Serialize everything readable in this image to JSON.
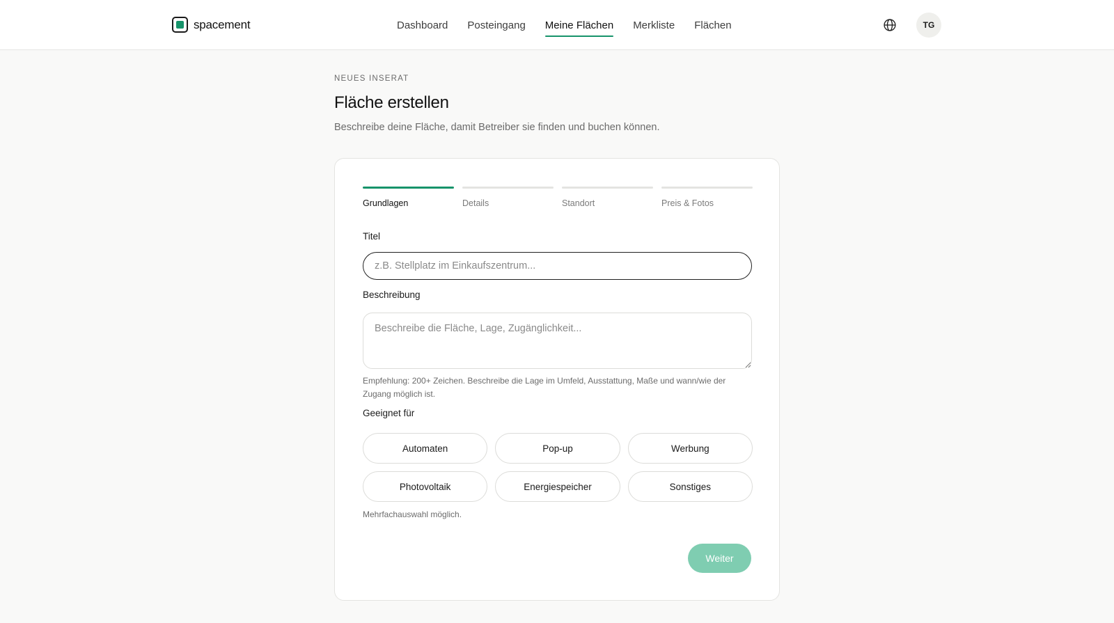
{
  "brand": {
    "name": "spacement",
    "accent_color": "#16936a",
    "logo_icon": "square-logo-icon"
  },
  "nav": {
    "items": [
      {
        "label": "Dashboard",
        "active": false
      },
      {
        "label": "Posteingang",
        "active": false
      },
      {
        "label": "Meine Flächen",
        "active": true
      },
      {
        "label": "Merkliste",
        "active": false
      },
      {
        "label": "Flächen",
        "active": false
      }
    ]
  },
  "header": {
    "language_icon": "globe-icon",
    "avatar_initials": "TG"
  },
  "page": {
    "eyebrow": "NEUES INSERAT",
    "title": "Fläche erstellen",
    "subtitle": "Beschreibe deine Fläche, damit Betreiber sie finden und buchen können."
  },
  "steps": [
    {
      "label": "Grundlagen",
      "active": true
    },
    {
      "label": "Details",
      "active": false
    },
    {
      "label": "Standort",
      "active": false
    },
    {
      "label": "Preis & Fotos",
      "active": false
    }
  ],
  "form": {
    "title_label": "Titel",
    "title_value": "",
    "title_placeholder": "z.B. Stellplatz im Einkaufszentrum...",
    "description_label": "Beschreibung",
    "description_value": "",
    "description_placeholder": "Beschreibe die Fläche, Lage, Zugänglichkeit...",
    "description_hint": "Empfehlung: 200+ Zeichen. Beschreibe die Lage im Umfeld, Ausstattung, Maße und wann/wie der Zugang möglich ist.",
    "suitable_label": "Geeignet für",
    "suitable_options": [
      "Automaten",
      "Pop-up",
      "Werbung",
      "Photovoltaik",
      "Energiespeicher",
      "Sonstiges"
    ],
    "suitable_hint": "Mehrfachauswahl möglich.",
    "next_label": "Weiter",
    "next_button_color": "#7fcdb1"
  }
}
